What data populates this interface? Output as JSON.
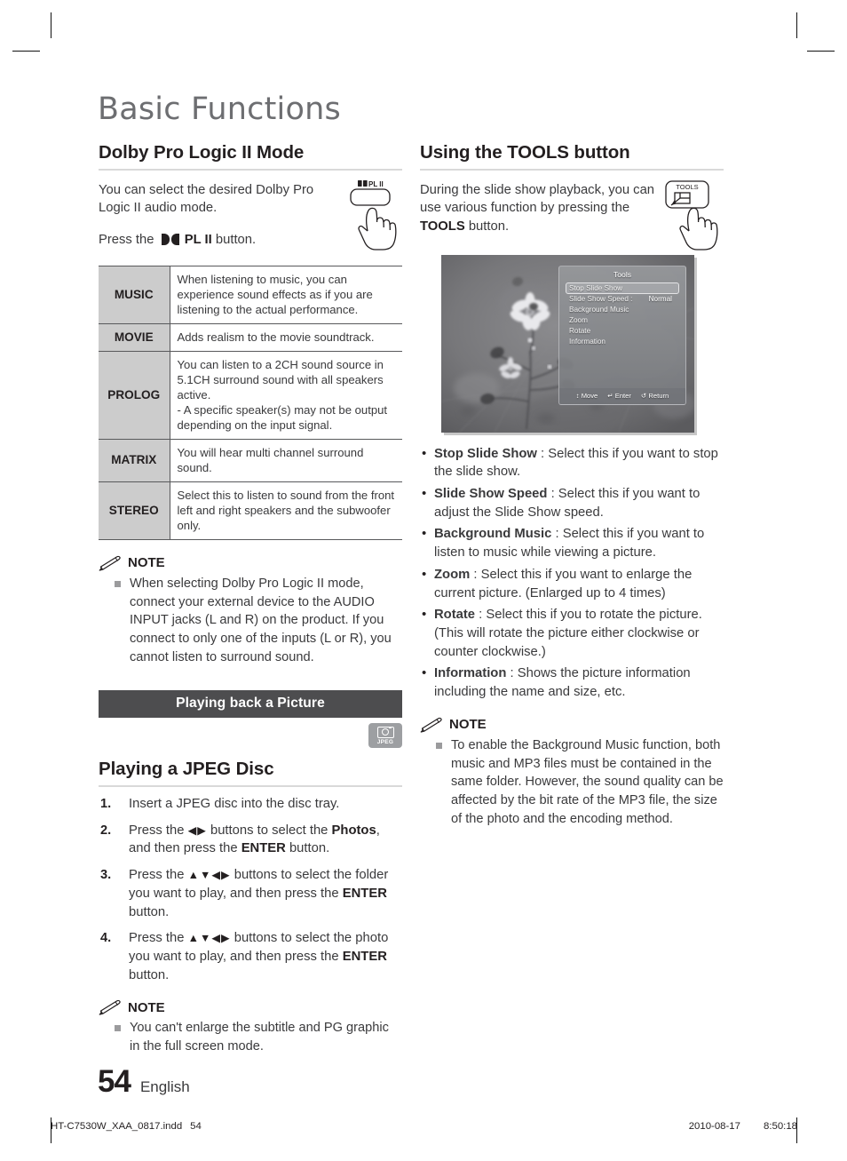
{
  "chapter": {
    "title": "Basic Functions"
  },
  "left": {
    "section1": {
      "heading": "Dolby Pro Logic II Mode",
      "intro": "You can select the desired Dolby Pro Logic II audio mode.",
      "press_prefix": "Press the",
      "press_button": "PL II",
      "press_suffix": "button.",
      "remote_label": "PL II",
      "table": [
        {
          "mode": "MUSIC",
          "desc": "When listening to music, you can experience sound effects as if you are listening to the actual performance."
        },
        {
          "mode": "MOVIE",
          "desc": "Adds realism to the movie soundtrack."
        },
        {
          "mode": "PROLOG",
          "desc": "You can listen to a 2CH sound source in 5.1CH surround sound with all speakers active.\n- A specific speaker(s) may not be output\n   depending on the input signal."
        },
        {
          "mode": "MATRIX",
          "desc": "You will hear multi channel surround sound."
        },
        {
          "mode": "STEREO",
          "desc": "Select this to listen to sound from the front left and right speakers and the subwoofer only."
        }
      ],
      "note_label": "NOTE",
      "notes": [
        "When selecting Dolby Pro Logic II mode, connect your external device to the AUDIO INPUT jacks (L and R) on the product. If you connect to only one of the inputs (L or R), you cannot listen to surround sound."
      ]
    },
    "banner": "Playing back a Picture",
    "media_badge": "JPEG",
    "section2": {
      "heading": "Playing a JPEG Disc",
      "steps": [
        {
          "num": "1.",
          "text": "Insert a JPEG disc into the disc tray."
        },
        {
          "num": "2.",
          "text_parts": [
            "Press the ",
            "◀▶",
            " buttons to select the ",
            "Photos",
            ", and then press the ",
            "ENTER",
            " button."
          ]
        },
        {
          "num": "3.",
          "text_parts": [
            "Press the ",
            "▲▼◀▶",
            " buttons to select the folder you want to play, and then press the ",
            "ENTER",
            " button."
          ]
        },
        {
          "num": "4.",
          "text_parts": [
            "Press the ",
            "▲▼◀▶",
            " buttons to select the photo you want to play, and then press the ",
            "ENTER",
            " button."
          ]
        }
      ],
      "note_label": "NOTE",
      "notes": [
        "You can't enlarge the subtitle and PG graphic in the full screen mode."
      ]
    }
  },
  "right": {
    "section1": {
      "heading": "Using the TOOLS button",
      "intro_prefix": "During the slide show playback, you can use various function by pressing the ",
      "intro_bold": "TOOLS",
      "intro_suffix": " button.",
      "remote_label": "TOOLS"
    },
    "tv_screen": {
      "menu_title": "Tools",
      "items": [
        {
          "label": "Stop Slide Show",
          "value": "",
          "selected": true
        },
        {
          "label": "Slide Show Speed :",
          "value": "Normal",
          "selected": false
        },
        {
          "label": "Background Music",
          "value": "",
          "selected": false
        },
        {
          "label": "Zoom",
          "value": "",
          "selected": false
        },
        {
          "label": "Rotate",
          "value": "",
          "selected": false
        },
        {
          "label": "Information",
          "value": "",
          "selected": false
        }
      ],
      "footer": [
        {
          "icon": "↕",
          "label": "Move"
        },
        {
          "icon": "↵",
          "label": "Enter"
        },
        {
          "icon": "↺",
          "label": "Return"
        }
      ]
    },
    "bullets": [
      {
        "term": "Stop Slide Show",
        "desc": " : Select this if you want to stop the slide show."
      },
      {
        "term": "Slide Show Speed",
        "desc": " : Select this if you want to adjust the Slide Show speed."
      },
      {
        "term": "Background Music",
        "desc": " : Select this if you want to listen to music while viewing a picture."
      },
      {
        "term": "Zoom",
        "desc": " : Select this if you want to enlarge the current picture. (Enlarged up to 4 times)"
      },
      {
        "term": "Rotate",
        "desc": " : Select this if you to rotate the picture. (This will rotate the picture either clockwise or counter clockwise.)"
      },
      {
        "term": "Information",
        "desc": " : Shows the picture information including the name and size, etc."
      }
    ],
    "note_label": "NOTE",
    "notes": [
      "To enable the Background Music function, both music and MP3 files must be contained in the same folder. However, the sound quality can be affected by the bit rate of the MP3 file, the size of the photo and the encoding method."
    ]
  },
  "footer": {
    "page_number": "54",
    "language": "English",
    "filename": "HT-C7530W_XAA_0817.indd",
    "file_page": "54",
    "date": "2010-08-17",
    "time": "8:50:18"
  }
}
